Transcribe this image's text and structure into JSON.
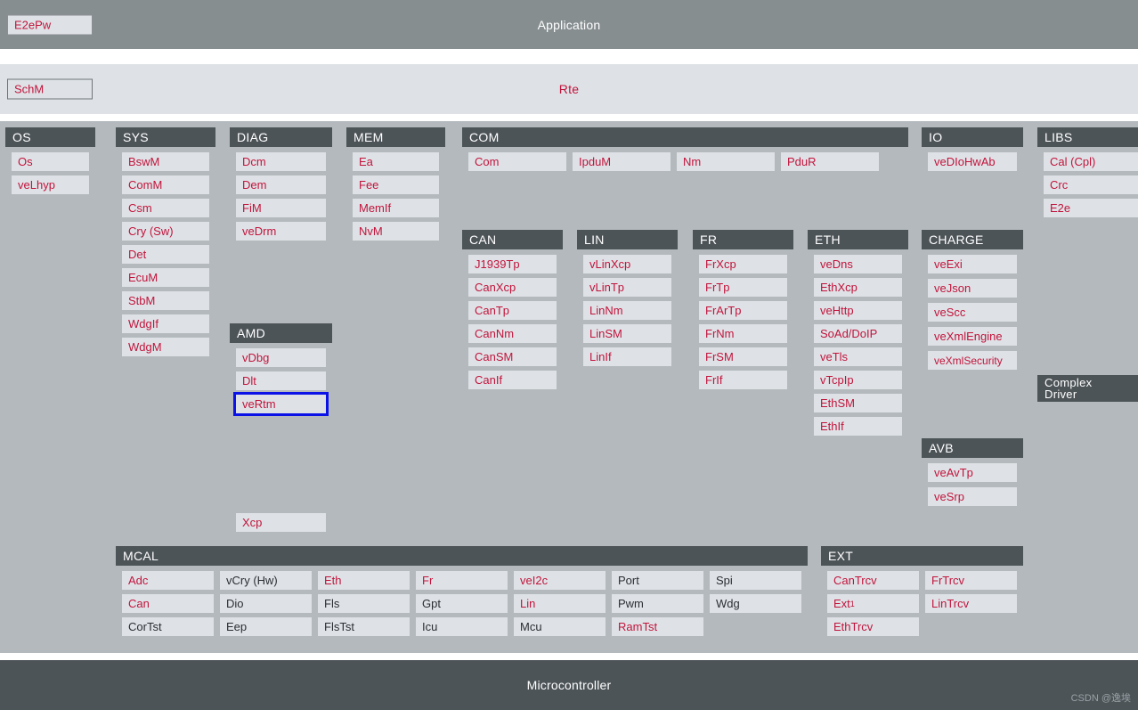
{
  "top": {
    "application_label": "Application",
    "e2epw_chip": "E2ePw",
    "rte_label": "Rte",
    "schm_chip": "SchM"
  },
  "bottom": {
    "microcontroller_label": "Microcontroller",
    "watermark": "CSDN @逸埃"
  },
  "colors": {
    "header_bg": "#4d5458",
    "panel_bg": "#b3b9bc",
    "item_bg": "#dee2e6",
    "accent_red": "#c2143c",
    "dark_text": "#2b2f33",
    "selection_blue": "#0a12e8",
    "app_band": "#868e90",
    "rte_band": "#dee2e6"
  },
  "panels": {
    "os": {
      "title": "OS",
      "items": [
        "Os",
        "veLhyp"
      ]
    },
    "sys": {
      "title": "SYS",
      "items": [
        "BswM",
        "ComM",
        "Csm",
        "Cry (Sw)",
        "Det",
        "EcuM",
        "StbM",
        "WdgIf",
        "WdgM"
      ]
    },
    "diag": {
      "title": "DIAG",
      "items": [
        "Dcm",
        "Dem",
        "FiM",
        "veDrm"
      ]
    },
    "amd": {
      "title": "AMD",
      "items": [
        "vDbg",
        "Dlt",
        "veRtm"
      ],
      "selected": "veRtm"
    },
    "xcp": {
      "title": "",
      "items": [
        "Xcp"
      ]
    },
    "mem": {
      "title": "MEM",
      "items": [
        "Ea",
        "Fee",
        "MemIf",
        "NvM"
      ]
    },
    "com": {
      "title": "COM",
      "items": [
        "Com",
        "IpduM",
        "Nm",
        "PduR"
      ]
    },
    "can": {
      "title": "CAN",
      "items": [
        "J1939Tp",
        "CanXcp",
        "CanTp",
        "CanNm",
        "CanSM",
        "CanIf"
      ]
    },
    "lin": {
      "title": "LIN",
      "items": [
        "vLinXcp",
        "vLinTp",
        "LinNm",
        "LinSM",
        "LinIf"
      ]
    },
    "fr": {
      "title": "FR",
      "items": [
        "FrXcp",
        "FrTp",
        "FrArTp",
        "FrNm",
        "FrSM",
        "FrIf"
      ]
    },
    "eth": {
      "title": "ETH",
      "items": [
        "veDns",
        "EthXcp",
        "veHttp",
        "SoAd/DoIP",
        "veTls",
        "vTcpIp",
        "EthSM",
        "EthIf"
      ]
    },
    "io": {
      "title": "IO",
      "items": [
        "veDIoHwAb"
      ]
    },
    "charge": {
      "title": "CHARGE",
      "items": [
        "veExi",
        "veJson",
        "veScc",
        "veXmlEngine",
        "veXmlSecurity"
      ]
    },
    "avb": {
      "title": "AVB",
      "items": [
        "veAvTp",
        "veSrp"
      ]
    },
    "libs": {
      "title": "LIBS",
      "items": [
        "Cal (Cpl)",
        "Crc",
        "E2e"
      ]
    },
    "complex_driver": {
      "title_line1": "Complex",
      "title_line2": "Driver",
      "items": []
    },
    "mcal": {
      "title": "MCAL",
      "columns": [
        [
          {
            "label": "Adc",
            "red": false
          },
          {
            "label": "Can",
            "red": true
          },
          {
            "label": "CorTst",
            "red": false
          }
        ],
        [
          {
            "label": "vCry (Hw)",
            "red": false
          },
          {
            "label": "Dio",
            "red": false
          },
          {
            "label": "Eep",
            "red": false
          }
        ],
        [
          {
            "label": "Eth",
            "red": true
          },
          {
            "label": "Fls",
            "red": false
          },
          {
            "label": "FlsTst",
            "red": false
          }
        ],
        [
          {
            "label": "Fr",
            "red": true
          },
          {
            "label": "Gpt",
            "red": false
          },
          {
            "label": "Icu",
            "red": false
          }
        ],
        [
          {
            "label": "veI2c",
            "red": true
          },
          {
            "label": "Lin",
            "red": true
          },
          {
            "label": "Mcu",
            "red": false
          }
        ],
        [
          {
            "label": "Port",
            "red": false
          },
          {
            "label": "Pwm",
            "red": false
          },
          {
            "label": "RamTst",
            "red": true
          }
        ],
        [
          {
            "label": "Spi",
            "red": false
          },
          {
            "label": "Wdg",
            "red": false
          }
        ]
      ]
    },
    "ext": {
      "title": "EXT",
      "columns": [
        [
          {
            "label": "CanTrcv",
            "sup": ""
          },
          {
            "label": "Ext",
            "sup": "1"
          },
          {
            "label": "EthTrcv",
            "sup": ""
          }
        ],
        [
          {
            "label": "FrTrcv",
            "sup": ""
          },
          {
            "label": "LinTrcv",
            "sup": ""
          }
        ]
      ]
    }
  }
}
